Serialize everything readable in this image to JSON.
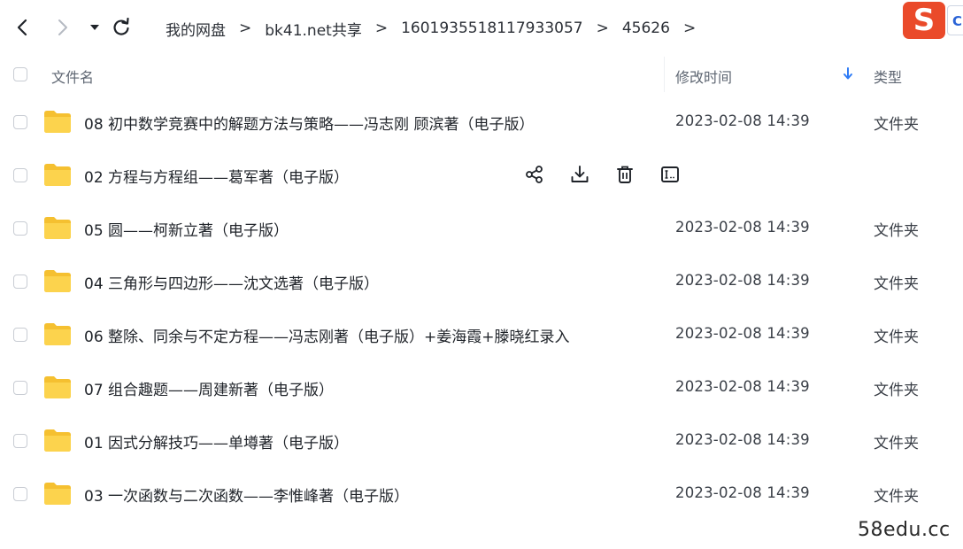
{
  "toolbar": {
    "breadcrumbs": [
      "我的网盘",
      "bk41.net共享",
      "1601935518117933057",
      "45626"
    ],
    "separator": ">",
    "logo_letter": "S",
    "logo_tab_letter": "C"
  },
  "header": {
    "name": "文件名",
    "time": "修改时间",
    "type": "类型"
  },
  "rows": [
    {
      "name": "08 初中数学竞赛中的解题方法与策略——冯志刚 顾滨著（电子版）",
      "time": "2023-02-08 14:39",
      "type": "文件夹"
    },
    {
      "name": "02 方程与方程组——葛军著（电子版）",
      "time": "",
      "type": ""
    },
    {
      "name": "05 圆——柯新立著（电子版）",
      "time": "2023-02-08 14:39",
      "type": "文件夹"
    },
    {
      "name": "04 三角形与四边形——沈文选著（电子版）",
      "time": "2023-02-08 14:39",
      "type": "文件夹"
    },
    {
      "name": "06 整除、同余与不定方程——冯志刚著（电子版）+姜海霞+滕晓红录入",
      "time": "2023-02-08 14:39",
      "type": "文件夹"
    },
    {
      "name": "07 组合趣题——周建新著（电子版）",
      "time": "2023-02-08 14:39",
      "type": "文件夹"
    },
    {
      "name": "01 因式分解技巧——单墫著（电子版）",
      "time": "2023-02-08 14:39",
      "type": "文件夹"
    },
    {
      "name": "03 一次函数与二次函数——李惟峰著（电子版）",
      "time": "2023-02-08 14:39",
      "type": "文件夹"
    }
  ],
  "hover_actions": [
    "share-icon",
    "download-icon",
    "delete-icon",
    "rename-icon"
  ],
  "watermark": "58edu.cc",
  "colors": {
    "folder": "#fcd34d",
    "folder_dark": "#f5c030",
    "sort_arrow": "#2f7cf6",
    "logo": "#ea4a2a"
  }
}
